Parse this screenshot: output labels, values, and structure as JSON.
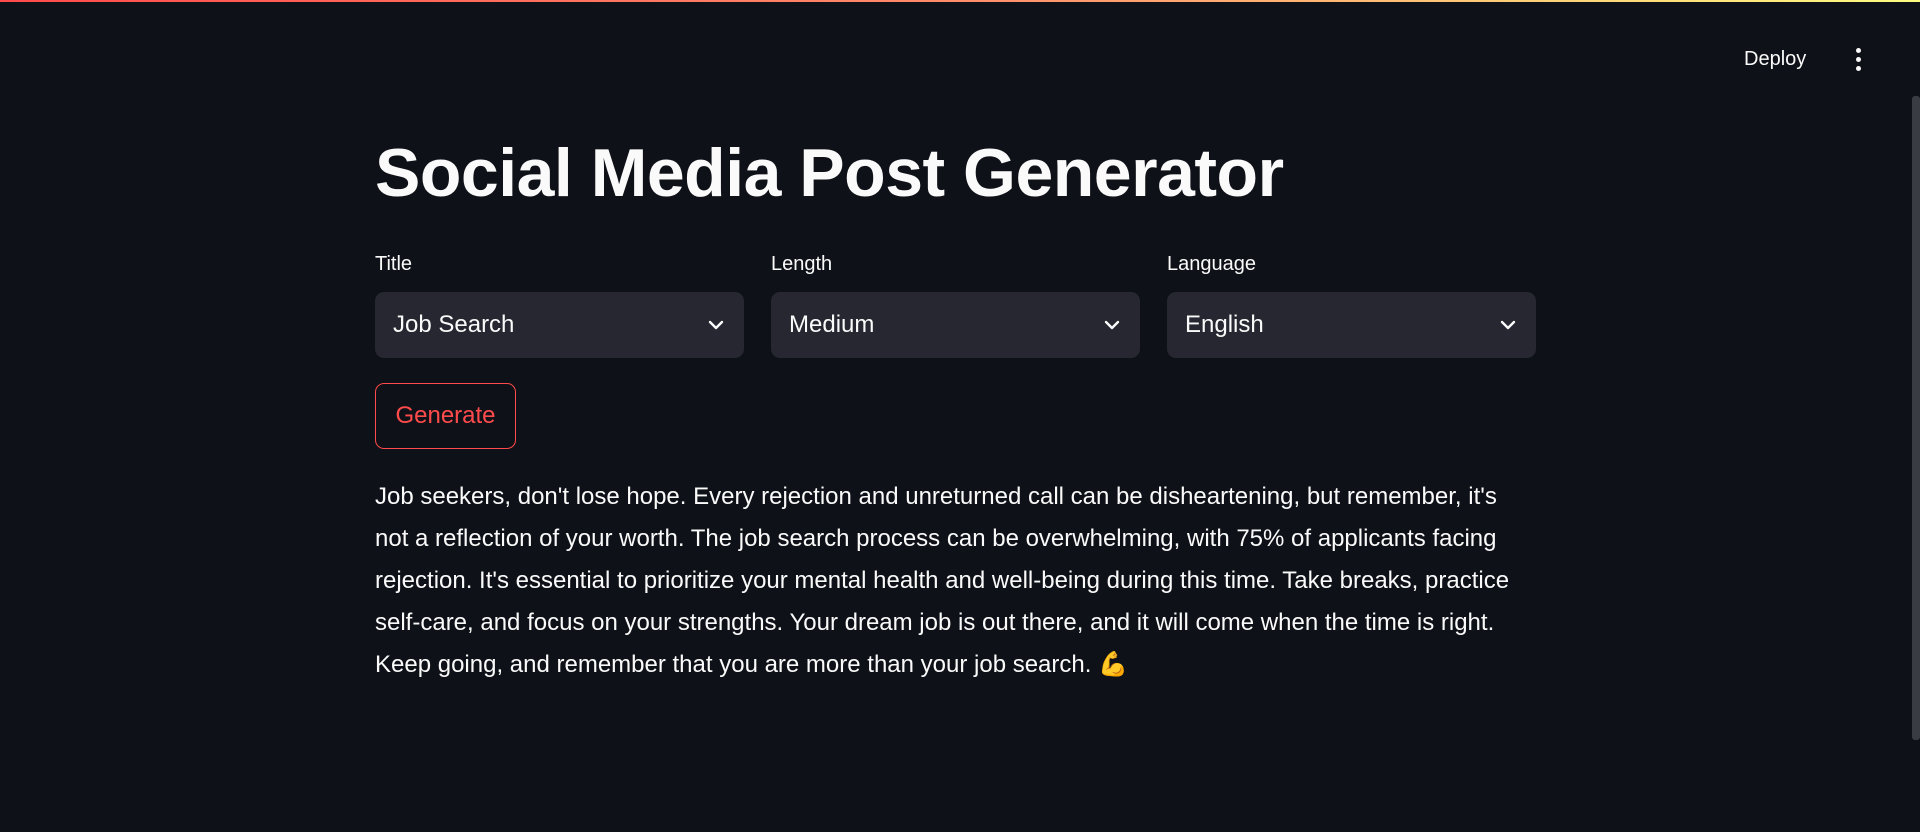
{
  "header": {
    "deploy_label": "Deploy",
    "menu_icon": "more-vertical-icon"
  },
  "main": {
    "title": "Social Media Post Generator",
    "fields": {
      "title": {
        "label": "Title",
        "value": "Job Search"
      },
      "length": {
        "label": "Length",
        "value": "Medium"
      },
      "language": {
        "label": "Language",
        "value": "English"
      }
    },
    "generate_label": "Generate",
    "output": "Job seekers, don't lose hope. Every rejection and unreturned call can be disheartening, but remember, it's not a reflection of your worth. The job search process can be overwhelming, with 75% of applicants facing rejection. It's essential to prioritize your mental health and well-being during this time. Take breaks, practice self-care, and focus on your strengths. Your dream job is out there, and it will come when the time is right. Keep going, and remember that you are more than your job search. 💪"
  },
  "colors": {
    "background": "#0e1117",
    "select_background": "#262730",
    "accent": "#ff4b4b",
    "text": "#fafafa"
  }
}
